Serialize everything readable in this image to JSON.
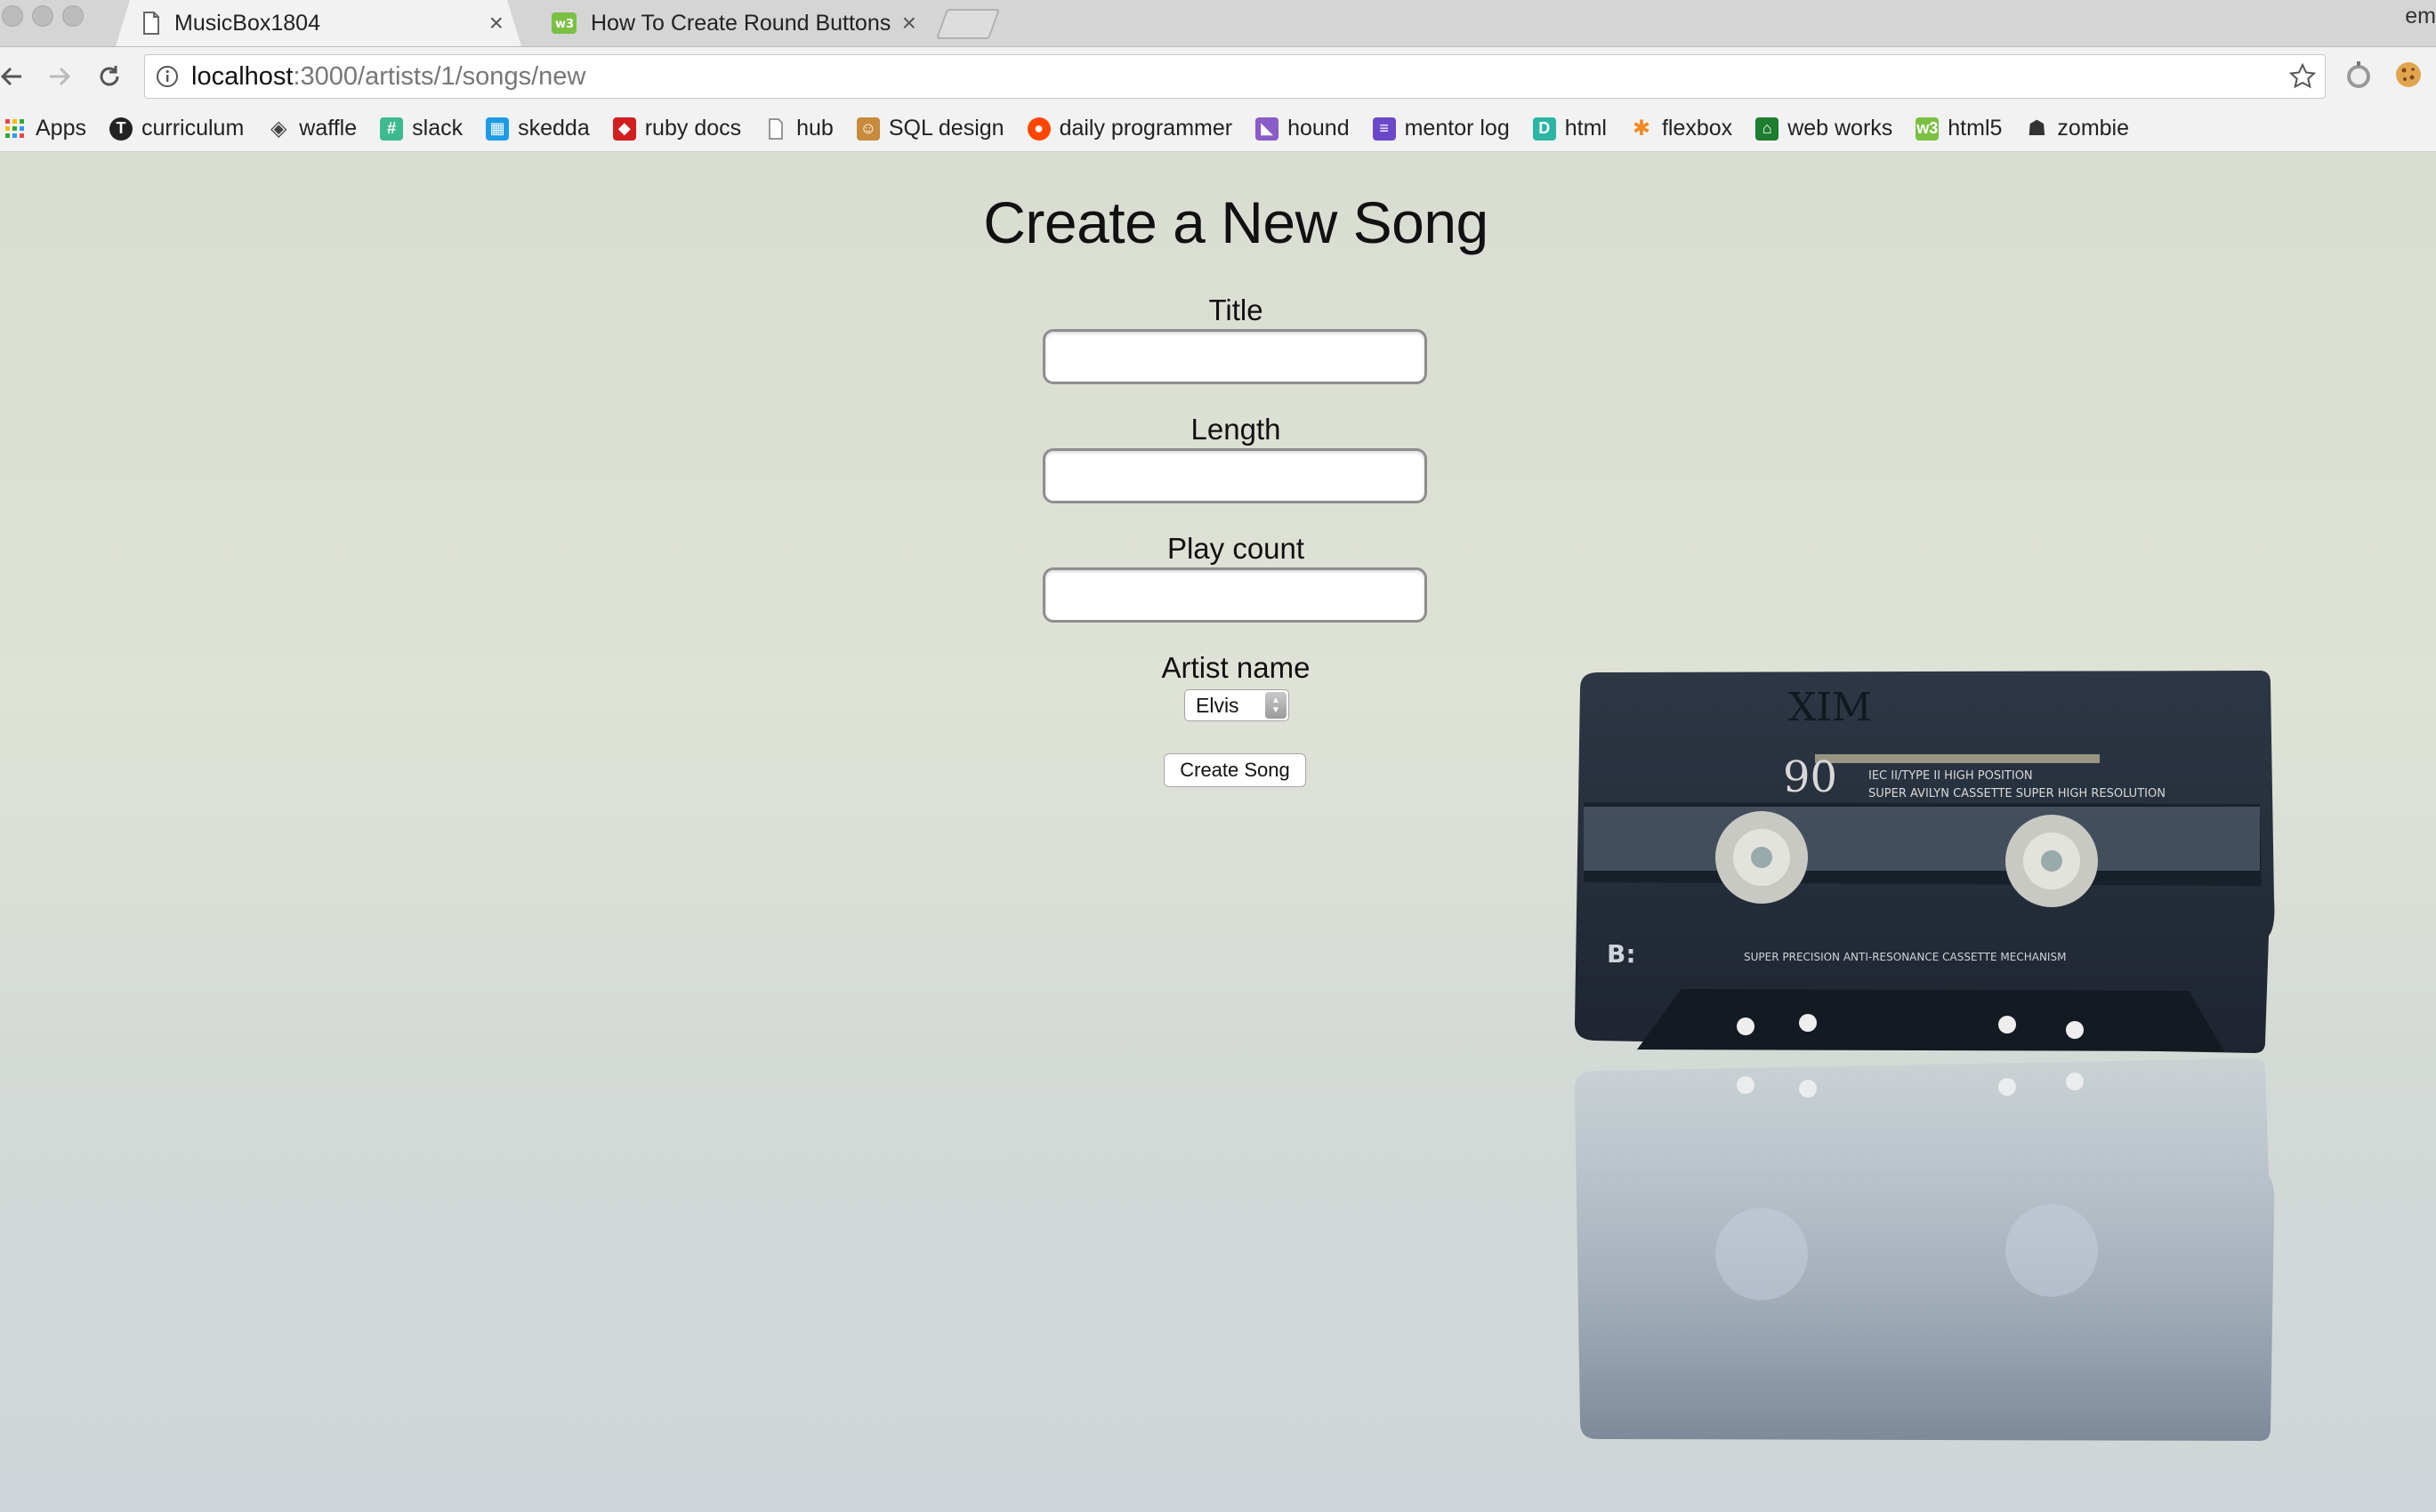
{
  "browser": {
    "tabs": [
      {
        "title": "MusicBox1804",
        "active": true
      },
      {
        "title": "How To Create Round Buttons",
        "active": false
      }
    ],
    "profile_label": "em",
    "url": {
      "host": "localhost",
      "path": ":3000/artists/1/songs/new"
    }
  },
  "bookmarks": [
    {
      "label": "Apps",
      "icon": "apps-grid-icon",
      "color": "#e44"
    },
    {
      "label": "curriculum",
      "icon": "turing-logo-icon",
      "color": "#222"
    },
    {
      "label": "waffle",
      "icon": "waffle-icon",
      "color": "#444"
    },
    {
      "label": "slack",
      "icon": "slack-icon",
      "color": "#3eb991"
    },
    {
      "label": "skedda",
      "icon": "calendar-icon",
      "color": "#1e9be6"
    },
    {
      "label": "ruby docs",
      "icon": "ruby-icon",
      "color": "#d21f1f"
    },
    {
      "label": "hub",
      "icon": "document-icon",
      "color": "#999"
    },
    {
      "label": "SQL design",
      "icon": "person-icon",
      "color": "#c88a3c"
    },
    {
      "label": "daily programmer",
      "icon": "reddit-icon",
      "color": "#ff4500"
    },
    {
      "label": "hound",
      "icon": "hound-icon",
      "color": "#8a5cc7"
    },
    {
      "label": "mentor log",
      "icon": "list-icon",
      "color": "#6b48c9"
    },
    {
      "label": "html",
      "icon": "html-icon",
      "color": "#2bb5a3"
    },
    {
      "label": "flexbox",
      "icon": "asterisk-icon",
      "color": "#f08a24"
    },
    {
      "label": "web works",
      "icon": "webworks-icon",
      "color": "#1e7d2f"
    },
    {
      "label": "html5",
      "icon": "w3-icon",
      "color": "#7bc043"
    },
    {
      "label": "zombie",
      "icon": "zombie-icon",
      "color": "#333"
    }
  ],
  "page": {
    "title": "Create a New Song",
    "fields": {
      "title_label": "Title",
      "length_label": "Length",
      "play_count_label": "Play count",
      "artist_label": "Artist name",
      "artist_selected": "Elvis"
    },
    "submit_label": "Create Song"
  },
  "background_image": {
    "cassette_side_label": "B:",
    "cassette_length": "90",
    "cassette_handwriting": "XIM",
    "cassette_spec_1": "IEC II/TYPE II HIGH POSITION",
    "cassette_spec_2": "SUPER AVILYN CASSETTE SUPER HIGH RESOLUTION",
    "cassette_mechanism": "SUPER PRECISION ANTI-RESONANCE CASSETTE MECHANISM"
  }
}
